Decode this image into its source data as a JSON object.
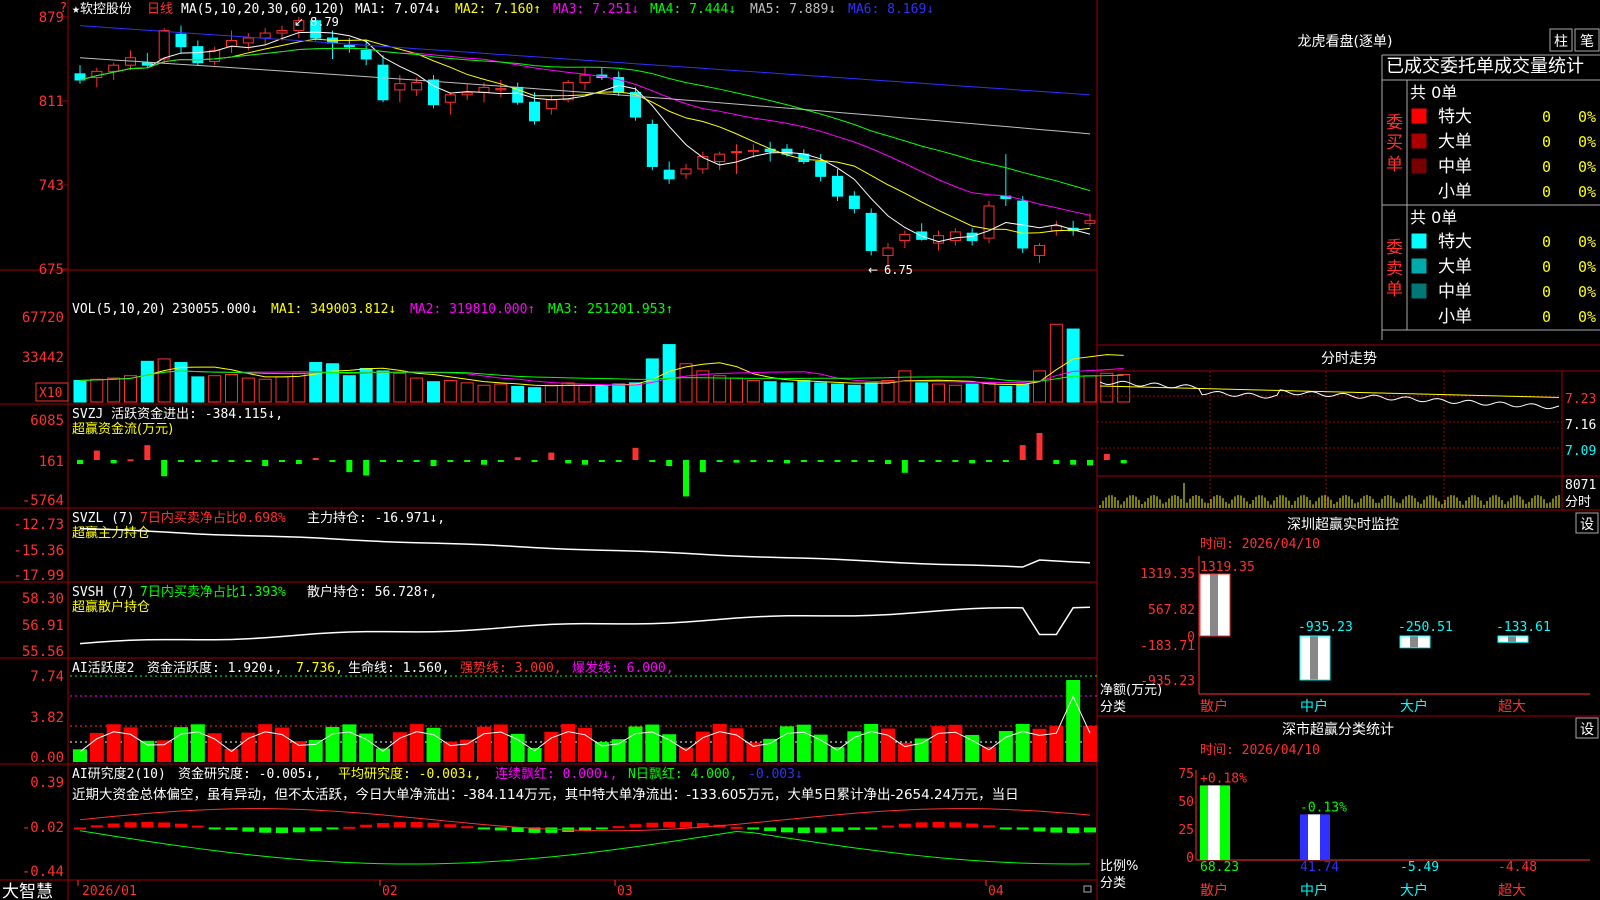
{
  "price_panel": {
    "stock_name": "★软控股份",
    "period": "日线",
    "ma_header": "MA(5,10,20,30,60,120)",
    "indicators": [
      {
        "label": "MA1: 7.074↓",
        "color": "#ffffff"
      },
      {
        "label": "MA2: 7.160↑",
        "color": "#ffff00"
      },
      {
        "label": "MA3: 7.251↓",
        "color": "#ff00ff"
      },
      {
        "label": "MA4: 7.444↓",
        "color": "#00ff00"
      },
      {
        "label": "MA5: 7.889↓",
        "color": "#c0c0c0"
      },
      {
        "label": "MA6: 8.169↓",
        "color": "#3030ff"
      }
    ],
    "y_ticks": [
      "879",
      "811",
      "743",
      "675"
    ],
    "high_mark": "8.79",
    "low_mark": "6.75"
  },
  "vol_panel": {
    "header": "VOL(5,10,20)",
    "value": "230055.000↓",
    "indicators": [
      {
        "label": "MA1: 349003.812↓",
        "color": "#ffff00"
      },
      {
        "label": "MA2: 319810.000↑",
        "color": "#ff00ff"
      },
      {
        "label": "MA3: 251201.953↑",
        "color": "#00ff00"
      }
    ],
    "y_ticks": [
      "67720",
      "33442"
    ],
    "unit_label": "X10"
  },
  "svzj_panel": {
    "header": "SVZJ  活跃资金进出: -384.115↓,",
    "subtitle": "超赢资金流(万元)",
    "y_ticks": [
      "6085",
      "161",
      "-5764"
    ]
  },
  "svzl_panel": {
    "name": "SVZL (7)",
    "pct_text": "7日内买卖净占比0.698%",
    "hold_text": "主力持仓: -16.971↓,",
    "subtitle": "超赢主力持仓",
    "y_ticks": [
      "-12.73",
      "-15.36",
      "-17.99"
    ]
  },
  "svsh_panel": {
    "name": "SVSH (7)",
    "pct_text": "7日内买卖净占比1.393%",
    "hold_text": "散户持仓: 56.728↑,",
    "subtitle": "超赢散户持仓",
    "y_ticks": [
      "58.30",
      "56.91",
      "55.56"
    ]
  },
  "ai_active_panel": {
    "name": "AI活跃度2",
    "fund_text": "资金活跃度: 1.920↓,",
    "v2": "7.736,",
    "life_text": "生命线: 1.560,",
    "strong_text": "强势线: 3.000,",
    "burst_text": "爆发线: 6.000,",
    "y_ticks": [
      "7.74",
      "3.82",
      "0.00"
    ]
  },
  "ai_research_panel": {
    "name": "AI研究度2(10)",
    "fund_text": "资金研究度: -0.005↓,",
    "avg_text": "平均研究度: -0.003↓,",
    "red_text": "连续飘红: 0.000↓,",
    "n_text": "N日飘红: 4.000,",
    "n2_text": "-0.003↓",
    "commentary": "近期大资金总体偏空，虽有异动，但不太活跃，今日大单净流出：-384.114万元，其中特大单净流出：-133.605万元，大单5日累计净出-2654.24万元，当日",
    "y_ticks": [
      "0.39",
      "-0.02",
      "-0.44"
    ]
  },
  "bottom_axis": {
    "brand": "大智慧",
    "labels": [
      "2026/01",
      "02",
      "03",
      "04"
    ]
  },
  "dragon_tiger": {
    "title": "龙虎看盘(逐单)",
    "btn_bar": "柱",
    "btn_pen": "笔",
    "subtitle": "已成交委托单成交量统计",
    "buy_label": "委买单",
    "sell_label": "委卖单",
    "buy_total": "共 0单",
    "sell_total": "共 0单",
    "buy_rows": [
      {
        "name": "特大",
        "count": "0",
        "pct": "0%",
        "color": "#ff0000"
      },
      {
        "name": "大单",
        "count": "0",
        "pct": "0%",
        "color": "#aa0000"
      },
      {
        "name": "中单",
        "count": "0",
        "pct": "0%",
        "color": "#770000"
      },
      {
        "name": "小单",
        "count": "0",
        "pct": "0%",
        "color": "#000000"
      }
    ],
    "sell_rows": [
      {
        "name": "特大",
        "count": "0",
        "pct": "0%",
        "color": "#00ffff"
      },
      {
        "name": "大单",
        "count": "0",
        "pct": "0%",
        "color": "#00aaaa"
      },
      {
        "name": "中单",
        "count": "0",
        "pct": "0%",
        "color": "#007777"
      },
      {
        "name": "小单",
        "count": "0",
        "pct": "0%",
        "color": "#000000"
      }
    ]
  },
  "intraday": {
    "title": "分时走势",
    "price_ticks": [
      "7.23",
      "7.16",
      "7.09"
    ],
    "vol_tick": "8071",
    "vol_label": "分时"
  },
  "monitor": {
    "title": "深圳超赢实时监控",
    "set_btn": "设",
    "time_label": "时间: 2026/04/10",
    "y_ticks": [
      "1319.35",
      "567.82",
      "0",
      "-183.71",
      "-935.23"
    ],
    "y_label": "净额(万元)",
    "x_label": "分类",
    "unit": "万元",
    "categories": [
      "散户",
      "中户",
      "大户",
      "超大"
    ],
    "values": [
      1319.35,
      -935.23,
      -250.51,
      -133.61
    ],
    "value_labels": [
      "1319.35",
      "-935.23",
      "-250.51",
      "-133.61"
    ]
  },
  "classify": {
    "title": "深市超赢分类统计",
    "set_btn": "设",
    "time_label": "时间: 2026/04/10",
    "y_ticks": [
      "75",
      "50",
      "25",
      "0"
    ],
    "y_label": "比例%",
    "x_label": "分类",
    "categories": [
      "散户",
      "中户",
      "大户",
      "超大"
    ],
    "bar_values": [
      0.18,
      -0.13,
      0,
      0
    ],
    "bar_labels": [
      "+0.18%",
      "-0.13%",
      "",
      ""
    ],
    "bottom_values": [
      "68.23",
      "41.74",
      "-5.49",
      "-4.48"
    ]
  },
  "chart_data": [
    {
      "type": "candlestick",
      "title": "软控股份 日线",
      "ylim": [
        6.75,
        8.79
      ],
      "note": "daily candles 2026/01-2026/04",
      "ohlc": [
        [
          8.33,
          8.4,
          8.25,
          8.28
        ],
        [
          8.3,
          8.38,
          8.22,
          8.35
        ],
        [
          8.35,
          8.42,
          8.28,
          8.4
        ],
        [
          8.4,
          8.52,
          8.36,
          8.46
        ],
        [
          8.42,
          8.5,
          8.38,
          8.4
        ],
        [
          8.45,
          8.7,
          8.41,
          8.68
        ],
        [
          8.65,
          8.72,
          8.5,
          8.55
        ],
        [
          8.55,
          8.6,
          8.4,
          8.42
        ],
        [
          8.43,
          8.55,
          8.4,
          8.52
        ],
        [
          8.55,
          8.68,
          8.5,
          8.6
        ],
        [
          8.58,
          8.66,
          8.52,
          8.62
        ],
        [
          8.62,
          8.7,
          8.56,
          8.66
        ],
        [
          8.66,
          8.72,
          8.6,
          8.68
        ],
        [
          8.68,
          8.79,
          8.62,
          8.76
        ],
        [
          8.76,
          8.79,
          8.6,
          8.62
        ],
        [
          8.62,
          8.68,
          8.45,
          8.58
        ],
        [
          8.56,
          8.62,
          8.5,
          8.55
        ],
        [
          8.52,
          8.6,
          8.4,
          8.45
        ],
        [
          8.4,
          8.48,
          8.1,
          8.12
        ],
        [
          8.2,
          8.32,
          8.1,
          8.25
        ],
        [
          8.2,
          8.3,
          8.15,
          8.26
        ],
        [
          8.28,
          8.32,
          8.05,
          8.08
        ],
        [
          8.1,
          8.18,
          8.0,
          8.16
        ],
        [
          8.16,
          8.25,
          8.12,
          8.18
        ],
        [
          8.18,
          8.26,
          8.1,
          8.22
        ],
        [
          8.2,
          8.28,
          8.14,
          8.21
        ],
        [
          8.22,
          8.26,
          8.08,
          8.1
        ],
        [
          8.1,
          8.18,
          7.92,
          7.95
        ],
        [
          8.05,
          8.16,
          8.0,
          8.12
        ],
        [
          8.12,
          8.28,
          8.1,
          8.26
        ],
        [
          8.26,
          8.38,
          8.2,
          8.32
        ],
        [
          8.32,
          8.38,
          8.28,
          8.3
        ],
        [
          8.3,
          8.35,
          8.15,
          8.18
        ],
        [
          8.18,
          8.22,
          7.95,
          7.98
        ],
        [
          7.92,
          7.96,
          7.55,
          7.58
        ],
        [
          7.55,
          7.62,
          7.44,
          7.48
        ],
        [
          7.52,
          7.6,
          7.48,
          7.56
        ],
        [
          7.56,
          7.7,
          7.52,
          7.66
        ],
        [
          7.62,
          7.7,
          7.55,
          7.68
        ],
        [
          7.7,
          7.76,
          7.52,
          7.7
        ],
        [
          7.7,
          7.76,
          7.65,
          7.71
        ],
        [
          7.72,
          7.78,
          7.62,
          7.7
        ],
        [
          7.72,
          7.76,
          7.66,
          7.68
        ],
        [
          7.68,
          7.72,
          7.6,
          7.62
        ],
        [
          7.62,
          7.68,
          7.46,
          7.5
        ],
        [
          7.5,
          7.56,
          7.3,
          7.34
        ],
        [
          7.34,
          7.38,
          7.2,
          7.24
        ],
        [
          7.2,
          7.24,
          6.86,
          6.9
        ],
        [
          6.86,
          6.96,
          6.75,
          6.92
        ],
        [
          6.98,
          7.06,
          6.92,
          7.03
        ],
        [
          7.05,
          7.12,
          6.98,
          6.99
        ],
        [
          6.96,
          7.06,
          6.9,
          7.02
        ],
        [
          6.98,
          7.08,
          6.94,
          7.05
        ],
        [
          7.04,
          7.08,
          6.94,
          6.98
        ],
        [
          7.0,
          7.3,
          6.96,
          7.26
        ],
        [
          7.34,
          7.68,
          7.26,
          7.32
        ],
        [
          7.3,
          7.34,
          6.88,
          6.92
        ],
        [
          6.86,
          6.96,
          6.8,
          6.94
        ],
        [
          7.06,
          7.14,
          7.02,
          7.1
        ],
        [
          7.08,
          7.14,
          7.02,
          7.06
        ],
        [
          7.12,
          7.2,
          7.1,
          7.14
        ]
      ]
    },
    {
      "type": "bar",
      "title": "VOL(5,10,20)",
      "ylim": [
        0,
        67720
      ],
      "values": [
        18000,
        19000,
        20000,
        22000,
        34000,
        36000,
        33000,
        21000,
        22000,
        23000,
        20000,
        19000,
        21000,
        24000,
        33000,
        32000,
        22000,
        28000,
        26000,
        24000,
        20000,
        17000,
        18000,
        16000,
        14000,
        15000,
        13000,
        12000,
        14000,
        16000,
        14000,
        13000,
        15000,
        16000,
        36000,
        48000,
        32000,
        26000,
        22000,
        20000,
        18000,
        17000,
        16000,
        18000,
        16000,
        15000,
        14000,
        16000,
        18000,
        26000,
        16000,
        15000,
        14000,
        15000,
        16000,
        13000,
        15000,
        26000,
        65000,
        61000,
        22000,
        24000,
        23000
      ]
    },
    {
      "type": "bar",
      "title": "SVZJ",
      "ylim": [
        -5764,
        6085
      ],
      "values": [
        -600,
        1400,
        -500,
        100,
        2200,
        -2400,
        -200,
        -200,
        -300,
        -200,
        -100,
        -900,
        -200,
        -600,
        300,
        -100,
        -1800,
        -2300,
        -300,
        -200,
        -100,
        -900,
        -300,
        -100,
        -700,
        -100,
        400,
        -200,
        1100,
        -500,
        -700,
        -300,
        -200,
        1800,
        -300,
        -900,
        -5400,
        -1800,
        -200,
        -400,
        -100,
        -300,
        -500,
        -300,
        -200,
        -100,
        -200,
        -300,
        -600,
        -1900,
        -100,
        -200,
        -300,
        -500,
        -100,
        -300,
        2200,
        4000,
        -600,
        -700,
        -800,
        900,
        -500
      ]
    },
    {
      "type": "line",
      "title": "SVZL",
      "ylim": [
        -17.99,
        -12.73
      ]
    },
    {
      "type": "line",
      "title": "SVSH",
      "ylim": [
        55.56,
        58.3
      ]
    },
    {
      "type": "bar",
      "title": "AI活跃度2",
      "ylim": [
        0,
        7.74
      ]
    },
    {
      "type": "line",
      "title": "AI研究度2",
      "ylim": [
        -0.44,
        0.39
      ]
    },
    {
      "type": "bar",
      "title": "深圳超赢实时监控",
      "categories": [
        "散户",
        "中户",
        "大户",
        "超大"
      ],
      "values": [
        1319.35,
        -935.23,
        -250.51,
        -133.61
      ],
      "ylabel": "净额(万元)",
      "ylim": [
        -935.23,
        1319.35
      ]
    },
    {
      "type": "bar",
      "title": "深市超赢分类统计",
      "categories": [
        "散户",
        "中户",
        "大户",
        "超大"
      ],
      "values": [
        68.23,
        41.74,
        -5.49,
        -4.48
      ],
      "ylabel": "比例%",
      "ylim": [
        0,
        75
      ]
    }
  ]
}
